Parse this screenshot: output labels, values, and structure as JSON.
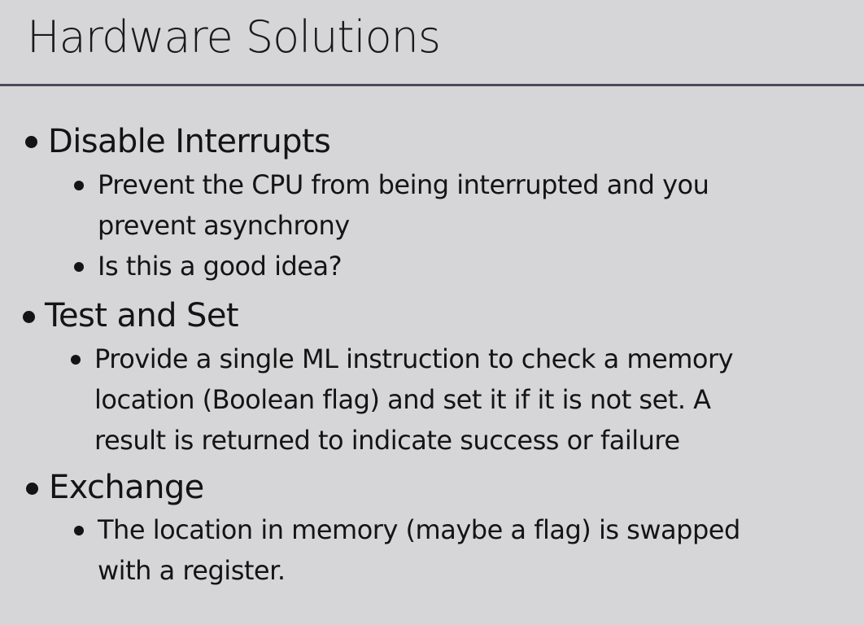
{
  "title": "Hardware Solutions",
  "bullets": [
    {
      "label": "Disable Interrupts",
      "sub": [
        {
          "lines": [
            "Prevent the CPU from being interrupted and you",
            "prevent asynchrony"
          ]
        },
        {
          "lines": [
            "Is this a good idea?"
          ]
        }
      ]
    },
    {
      "label": "Test and Set",
      "sub": [
        {
          "lines": [
            "Provide a single ML instruction to check a memory",
            "location (Boolean flag) and set it if it is not set. A",
            "result is returned to indicate success or failure"
          ]
        }
      ]
    },
    {
      "label": "Exchange",
      "sub": [
        {
          "lines": [
            "The location in memory (maybe a flag) is swapped",
            "with a register."
          ]
        }
      ]
    }
  ]
}
